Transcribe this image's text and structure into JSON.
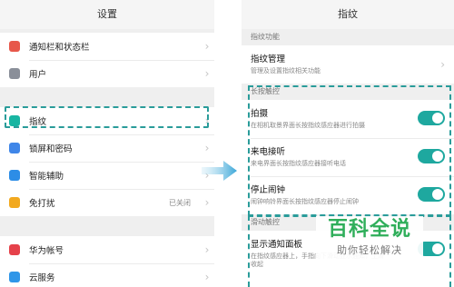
{
  "left_screen": {
    "title": "设置",
    "groups": [
      [
        {
          "label": "通知栏和状态栏",
          "icon": "notification-icon",
          "color": "#e7584b",
          "value": ""
        },
        {
          "label": "用户",
          "icon": "user-icon",
          "color": "#8a8f99",
          "value": ""
        }
      ],
      [
        {
          "label": "指纹",
          "icon": "fingerprint-icon",
          "color": "#18b5a2",
          "value": ""
        },
        {
          "label": "锁屏和密码",
          "icon": "lock-icon",
          "color": "#3f86e8",
          "value": ""
        },
        {
          "label": "智能辅助",
          "icon": "hand-icon",
          "color": "#2d8de6",
          "value": ""
        },
        {
          "label": "免打扰",
          "icon": "moon-icon",
          "color": "#f2a91f",
          "value": "已关闭"
        }
      ],
      [
        {
          "label": "华为帐号",
          "icon": "huawei-icon",
          "color": "#e5414a",
          "value": ""
        },
        {
          "label": "云服务",
          "icon": "cloud-icon",
          "color": "#2f96e8",
          "value": ""
        }
      ]
    ]
  },
  "right_screen": {
    "title": "指纹",
    "section_function": "指纹功能",
    "manage": {
      "name": "指纹管理",
      "desc": "管理及设置指纹相关功能"
    },
    "section_gesture": "长按触控",
    "gesture_items": [
      {
        "name": "拍摄",
        "desc": "在相机取景界面长按指纹感应器进行拍摄",
        "on": true
      },
      {
        "name": "来电接听",
        "desc": "来电界面长按指纹感应器接听电话",
        "on": true
      },
      {
        "name": "停止闹钟",
        "desc": "闹钟响铃界面长按指纹感应器停止闹钟",
        "on": true
      }
    ],
    "section_slide": "滑动触控",
    "slide_items": [
      {
        "name": "显示通知面板",
        "desc": "在指纹感应器上，手指向下滑动显示通知，上滑收起",
        "on": true
      }
    ]
  },
  "watermark": {
    "main": "百科全说",
    "sub": "助你轻松解决"
  },
  "colors": {
    "accent": "#1ea89f",
    "highlight": "#2a9c9a",
    "watermark": "#2fae5a"
  }
}
